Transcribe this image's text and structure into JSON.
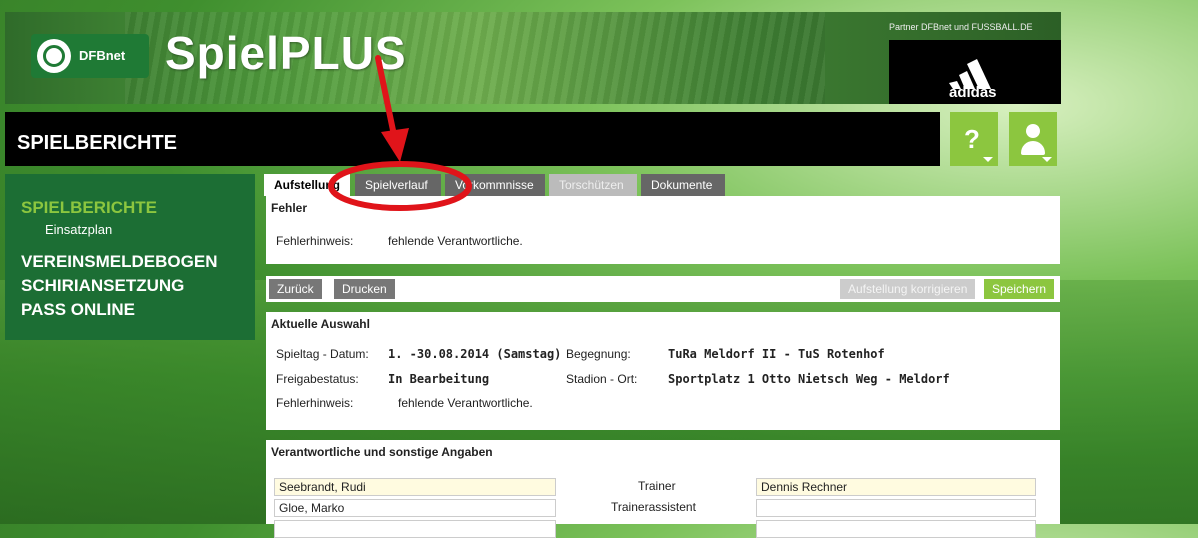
{
  "header": {
    "logo_text": "DFBnet",
    "brand": "SpielPLUS",
    "partner": "Partner DFBnet und FUSSBALL.DE",
    "sponsor": "adidas",
    "page_title": "SPIELBERICHTE",
    "help_glyph": "?",
    "help_icon": "question-icon",
    "user_icon": "user-icon"
  },
  "sidebar": {
    "items": [
      {
        "label": "SPIELBERICHTE",
        "active": true
      },
      {
        "label": "Einsatzplan",
        "sub": true
      },
      {
        "label": "VEREINSMELDEBOGEN"
      },
      {
        "label": "SCHIRIANSETZUNG"
      },
      {
        "label": "PASS ONLINE"
      }
    ]
  },
  "tabs": [
    {
      "label": "Aufstellung",
      "state": "active"
    },
    {
      "label": "Spielverlauf",
      "state": "normal"
    },
    {
      "label": "Vorkommnisse",
      "state": "normal"
    },
    {
      "label": "Torschützen",
      "state": "disabled"
    },
    {
      "label": "Dokumente",
      "state": "normal"
    }
  ],
  "fehler": {
    "title": "Fehler",
    "hint_label": "Fehlerhinweis:",
    "hint_value": "fehlende Verantwortliche."
  },
  "buttons": {
    "back": "Zurück",
    "print": "Drucken",
    "correct": "Aufstellung korrigieren",
    "save": "Speichern"
  },
  "auswahl": {
    "title": "Aktuelle Auswahl",
    "spieltag_label": "Spieltag - Datum:",
    "spieltag_value": "1. -30.08.2014 (Samstag)",
    "begegnung_label": "Begegnung:",
    "begegnung_value": "TuRa Meldorf II - TuS Rotenhof",
    "freigabe_label": "Freigabestatus:",
    "freigabe_value": "In Bearbeitung",
    "stadion_label": "Stadion - Ort:",
    "stadion_value": "Sportplatz 1 Otto Nietsch Weg - Meldorf",
    "hint_label": "Fehlerhinweis:",
    "hint_value": "fehlende Verantwortliche."
  },
  "verantwortliche": {
    "title": "Verantwortliche und sonstige Angaben",
    "rows": [
      {
        "left": "Seebrandt, Rudi",
        "role": "Trainer",
        "right": "Dennis Rechner"
      },
      {
        "left": "Gloe, Marko",
        "role": "Trainerassistent",
        "right": ""
      }
    ]
  },
  "colors": {
    "accent": "#8cc63f",
    "sidebar": "#1c6e34",
    "annotation": "#e0141a"
  }
}
